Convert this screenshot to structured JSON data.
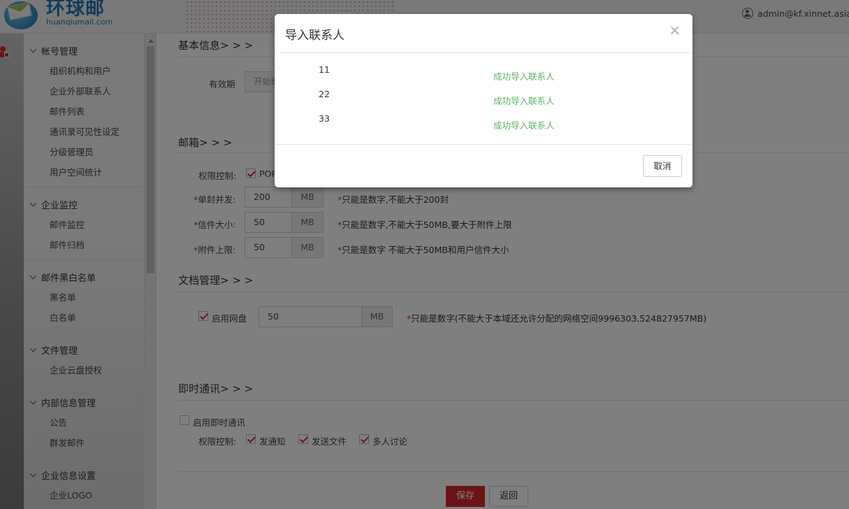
{
  "header": {
    "logo_cn": "环球邮",
    "logo_en": "huanqiumail.com",
    "user_email": "admin@kf.xinnet.asia"
  },
  "sidebar": {
    "groups": [
      {
        "title": "帐号管理",
        "items": [
          "组织机构和用户",
          "企业外部联系人",
          "邮件列表",
          "通讯录可见性设定",
          "分级管理员",
          "用户空间统计"
        ]
      },
      {
        "title": "企业监控",
        "items": [
          "邮件监控",
          "邮件归档"
        ]
      },
      {
        "title": "邮件黑白名单",
        "items": [
          "黑名单",
          "白名单"
        ]
      },
      {
        "title": "文件管理",
        "items": [
          "企业云盘授权"
        ]
      },
      {
        "title": "内部信息管理",
        "items": [
          "公告",
          "群发邮件"
        ]
      },
      {
        "title": "企业信息设置",
        "items": [
          "企业LOGO"
        ]
      }
    ]
  },
  "main": {
    "basic": {
      "title": "基本信息> > >",
      "validity_label": "有效期",
      "start_placeholder": "开始时"
    },
    "mailbox": {
      "title": "邮箱> > >",
      "perm_label": "权限控制:",
      "perm_pop": "POP",
      "single_label": "单封并发:",
      "single_value": "200",
      "single_unit": "MB",
      "single_hint": "只能是数字,不能大于200封",
      "size_label": "信件大小:",
      "size_value": "50",
      "size_unit": "MB",
      "size_hint": "只能是数字,不能大于50MB,要大于附件上限",
      "attach_label": "附件上限:",
      "attach_value": "50",
      "attach_unit": "MB",
      "attach_hint": "只能是数字 不能大于50MB和用户信件大小"
    },
    "docs": {
      "title": "文档管理> > >",
      "netdisk_label": "启用网盘",
      "netdisk_value": "50",
      "netdisk_unit": "MB",
      "netdisk_hint": "只能是数字(不能大于本域还允许分配的网络空间9996303.524827957MB)"
    },
    "im": {
      "title": "即时通讯> > >",
      "enable_label": "启用即时通讯",
      "perm_label": "权限控制:",
      "opt_notice": "发通知",
      "opt_file": "发送文件",
      "opt_group": "多人讨论"
    },
    "save": "保存",
    "back": "返回"
  },
  "modal": {
    "title": "导入联系人",
    "close": "×",
    "rows": [
      {
        "name": "11",
        "status": "成功导入联系人"
      },
      {
        "name": "22",
        "status": "成功导入联系人"
      },
      {
        "name": "33",
        "status": "成功导入联系人"
      }
    ],
    "cancel": "取消"
  },
  "colors": {
    "accent": "#d9262c",
    "success": "#5cb85c",
    "brand": "#1f78b4"
  }
}
